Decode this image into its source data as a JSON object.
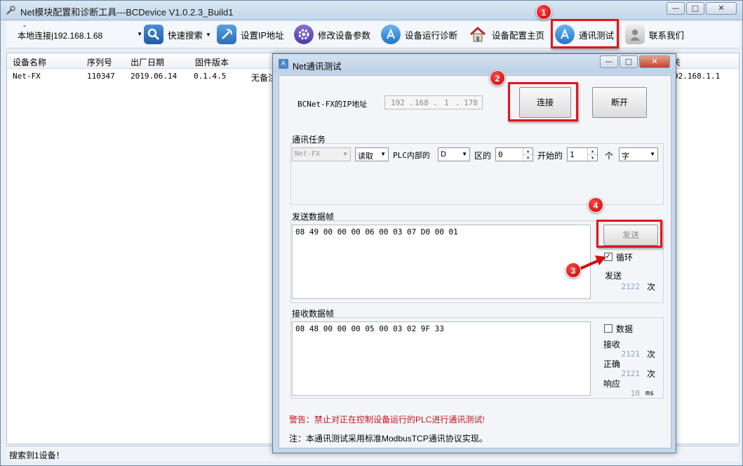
{
  "window": {
    "title": "Net模块配置和诊断工具---BCDevice V1.0.2.3_Build1",
    "min": "—",
    "max": "□",
    "close": "✕"
  },
  "toolbar": {
    "connection": "本地连接|192.168.1.68",
    "connection_dash": "-",
    "quick_search": "快速搜索",
    "set_ip": "设置IP地址",
    "modify_params": "修改设备参数",
    "diagnose": "设备运行诊断",
    "config_home": "设备配置主页",
    "comm_test": "通讯测试",
    "contact": "联系我们"
  },
  "table": {
    "headers": [
      "设备名称",
      "序列号",
      "出厂日期",
      "固件版本",
      "关"
    ],
    "row": {
      "name": "Net-FX",
      "serial": "110347",
      "date": "2019.06.14",
      "firmware": "0.1.4.5",
      "note": "无备注",
      "gateway": "92.168.1.1"
    }
  },
  "status": "搜索到1设备！",
  "dialog": {
    "title": "Net通讯测试",
    "ip_label": "BCNet-FX的IP地址",
    "ip": [
      "192",
      "168",
      "1",
      "178"
    ],
    "connect": "连接",
    "disconnect": "断开",
    "task_group": "通讯任务",
    "device_type": "Net-FX",
    "op": "读取",
    "plc_inside": "PLC内部的",
    "area": "D",
    "area_suffix": "区的",
    "start_addr": "0",
    "start_suffix": "开始的",
    "count": "1",
    "count_unit": "个",
    "unit": "字",
    "send_group": "发送数据帧",
    "send_frame": "08 49 00 00 00 06 00 03 07 D0 00 01",
    "send_btn": "发送",
    "loop_label": "循环",
    "loop_checked": "✓",
    "send_label": "发送",
    "send_count": "2122",
    "times": "次",
    "recv_group": "接收数据帧",
    "recv_frame": "08 48 00 00 00 05 00 03 02 9F 33",
    "data_label": "数据",
    "recv_label": "接收",
    "recv_count": "2121",
    "correct_label": "正确",
    "correct_count": "2121",
    "resp_label": "响应",
    "resp_ms": "10",
    "ms": "ms",
    "warning": "警告：禁止对正在控制设备运行的PLC进行通讯测试!",
    "note": "注：本通讯测试采用标准ModbusTCP通讯协议实现。"
  },
  "markers": [
    "1",
    "2",
    "3",
    "4"
  ],
  "colors": {
    "highlight": "#e0151c",
    "accent": "#4a86c8"
  }
}
